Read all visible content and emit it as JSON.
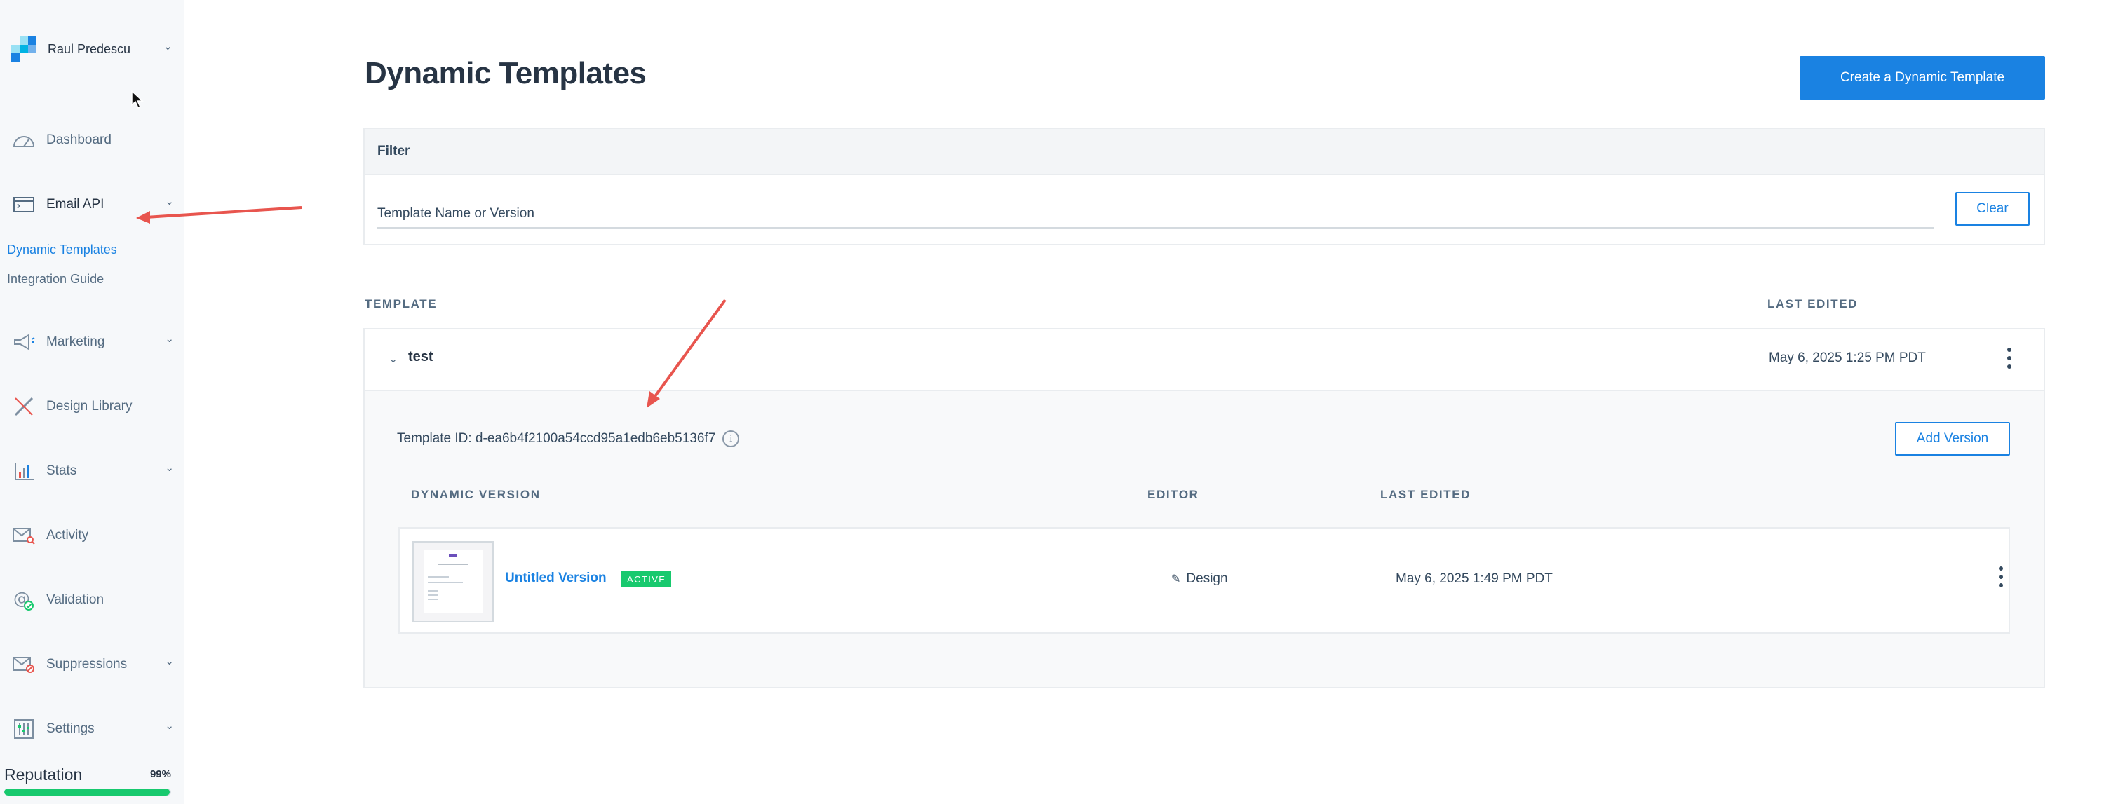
{
  "account": {
    "name": "Raul Predescu"
  },
  "sidebar": {
    "items": [
      {
        "label": "Dashboard",
        "icon": "speedometer-icon"
      },
      {
        "label": "Email API",
        "icon": "terminal-window-icon"
      },
      {
        "label": "Marketing",
        "icon": "megaphone-icon"
      },
      {
        "label": "Design Library",
        "icon": "pencil-ruler-icon"
      },
      {
        "label": "Stats",
        "icon": "bar-chart-icon"
      },
      {
        "label": "Activity",
        "icon": "envelope-search-icon"
      },
      {
        "label": "Validation",
        "icon": "at-check-icon"
      },
      {
        "label": "Suppressions",
        "icon": "envelope-block-icon"
      },
      {
        "label": "Settings",
        "icon": "sliders-icon"
      }
    ],
    "subitems": [
      {
        "label": "Dynamic Templates",
        "active": true
      },
      {
        "label": "Integration Guide",
        "active": false
      }
    ],
    "reputation": {
      "label": "Reputation",
      "value_text": "99%",
      "value": 0.99
    }
  },
  "page": {
    "title": "Dynamic Templates",
    "create_button": "Create a Dynamic Template"
  },
  "filter": {
    "heading": "Filter",
    "placeholder": "Template Name or Version",
    "clear_button": "Clear"
  },
  "table": {
    "col_template": "TEMPLATE",
    "col_last_edited": "LAST EDITED"
  },
  "template": {
    "name": "test",
    "last_edited": "May 6, 2025 1:25 PM PDT",
    "id_text": "Template ID: d-ea6b4f2100a54ccd95a1edb6eb5136f7",
    "add_version_button": "Add Version",
    "versions_header": {
      "version": "DYNAMIC VERSION",
      "editor": "EDITOR",
      "last_edited": "LAST EDITED"
    },
    "versions": [
      {
        "name": "Untitled Version",
        "badge": "ACTIVE",
        "editor": "Design",
        "last_edited": "May 6, 2025 1:49 PM PDT"
      }
    ]
  },
  "colors": {
    "accent": "#1a82e2",
    "success": "#18c96e",
    "annotation": "#e8554e"
  }
}
